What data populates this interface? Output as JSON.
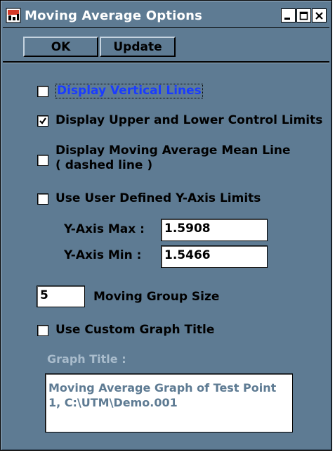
{
  "window": {
    "title": "Moving Average Options",
    "controls": {
      "minimize": "minimize",
      "maximize": "maximize",
      "close": "close"
    }
  },
  "toolbar": {
    "ok_label": "OK",
    "update_label": "Update"
  },
  "options": [
    {
      "label": "Display Vertical Lines",
      "checked": false
    },
    {
      "label": "Display Upper and Lower Control Limits",
      "checked": true
    },
    {
      "label": "Display Moving Average Mean Line\n( dashed line )",
      "checked": false
    },
    {
      "label": "Use User Defined Y-Axis Limits",
      "checked": false
    }
  ],
  "y_axis": {
    "max_label": "Y-Axis Max :",
    "max_value": "1.5908",
    "min_label": "Y-Axis Min :",
    "min_value": "1.5466"
  },
  "moving_group": {
    "value": "5",
    "label": "Moving Group Size"
  },
  "custom_title": {
    "label": "Use Custom Graph Title",
    "checked": false
  },
  "graph_title": {
    "label": "Graph Title :",
    "value": "Moving Average Graph of Test Point\n1, C:\\UTM\\Demo.001"
  },
  "colors": {
    "window_bg": "#5e7b93",
    "link_blue": "#1a3cff",
    "disabled_text": "#a9bccc"
  }
}
